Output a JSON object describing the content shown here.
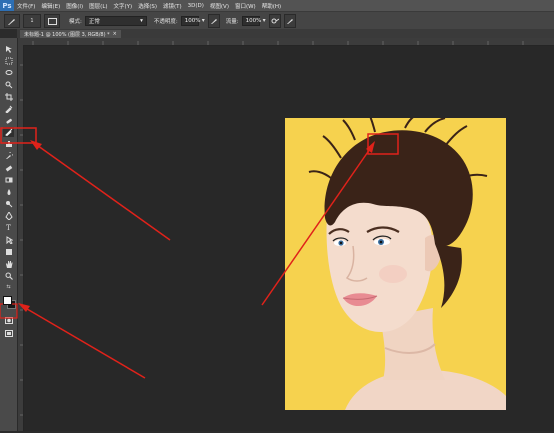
{
  "app": {
    "logo": "Ps"
  },
  "menu": {
    "items": [
      "文件(F)",
      "编辑(E)",
      "图像(I)",
      "图层(L)",
      "文字(Y)",
      "选择(S)",
      "滤镜(T)",
      "3D(D)",
      "视图(V)",
      "窗口(W)",
      "帮助(H)"
    ]
  },
  "options": {
    "mode_label": "模式:",
    "mode_value": "正常",
    "opacity_label": "不透明度:",
    "opacity_value": "100%",
    "flow_label": "流量:",
    "flow_value": "100%",
    "brush_size": "1"
  },
  "document": {
    "tab_label": "未标题-1 @ 100% (图层 3, RGB/8) *",
    "close_glyph": "×"
  },
  "colors": {
    "accent_red": "#e0221a",
    "photo_bg": "#f6d24e"
  },
  "tools": [
    "move-icon",
    "marquee-icon",
    "lasso-icon",
    "quick-select-icon",
    "crop-icon",
    "eyedropper-icon",
    "healing-icon",
    "brush-icon",
    "stamp-icon",
    "history-brush-icon",
    "eraser-icon",
    "gradient-icon",
    "blur-icon",
    "dodge-icon",
    "pen-icon",
    "type-icon",
    "path-select-icon",
    "shape-icon",
    "hand-icon",
    "zoom-icon"
  ]
}
